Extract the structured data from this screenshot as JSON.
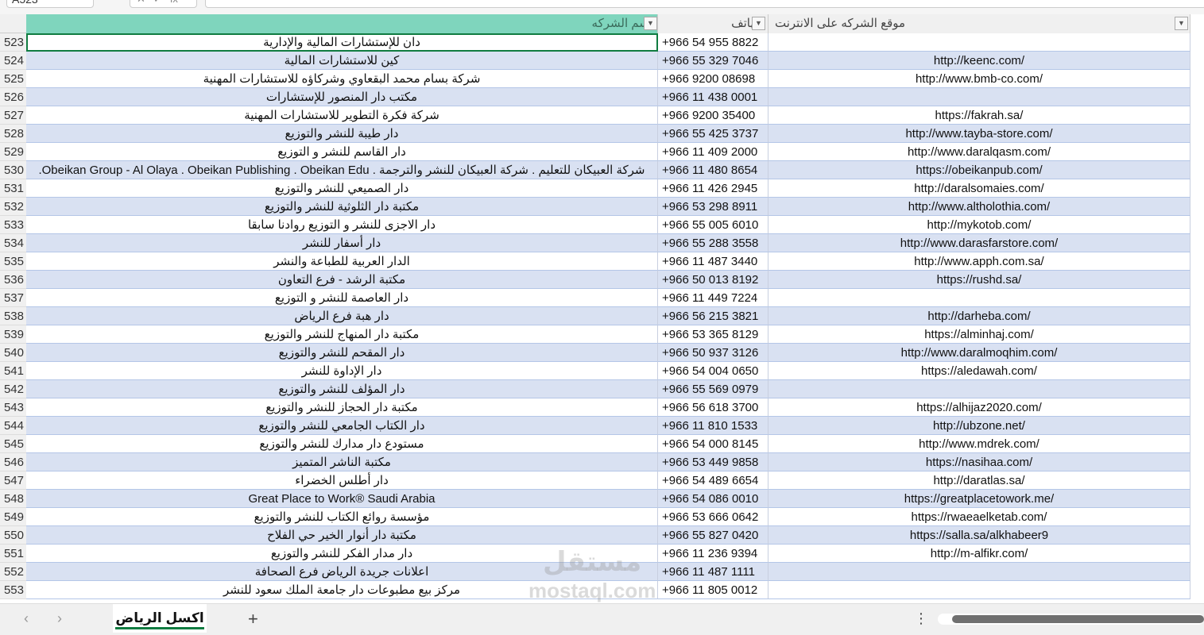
{
  "namebox": "A523",
  "formula_icons": [
    "close-icon",
    "check-icon",
    "fx"
  ],
  "fx_label": "fx",
  "headers": [
    "اسم الشركه",
    "الهاتف",
    "موقع الشركه  على الانترنت"
  ],
  "rows": [
    {
      "n": "523",
      "name": "دان للإستشارات المالية والإدارية",
      "phone": "+966 54 955 8822",
      "web": ""
    },
    {
      "n": "524",
      "name": "كين للاستشارات المالية",
      "phone": "+966 55 329 7046",
      "web": "http://keenc.com/"
    },
    {
      "n": "525",
      "name": "شركة بسام محمد البقعاوي وشركاؤه للاستشارات المهنية",
      "phone": "+966 9200 08698",
      "web": "http://www.bmb-co.com/"
    },
    {
      "n": "526",
      "name": "مكتب دار المنصور للإستشارات",
      "phone": "+966 11 438 0001",
      "web": ""
    },
    {
      "n": "527",
      "name": "شركة فكرة التطوير للاستشارات المهنية",
      "phone": "+966 9200 35400",
      "web": "https://fakrah.sa/"
    },
    {
      "n": "528",
      "name": "دار طيبة للنشر والتوزيع",
      "phone": "+966 55 425 3737",
      "web": "http://www.tayba-store.com/"
    },
    {
      "n": "529",
      "name": "دار القاسم للنشر و التوزيع",
      "phone": "+966 11 409 2000",
      "web": "http://www.daralqasm.com/"
    },
    {
      "n": "530",
      "name": "شركة العبيكان للتعليم . شركة العبيكان للنشر والترجمة . Obeikan Group - Al Olaya . Obeikan Publishing . Obeikan Edu.",
      "phone": "+966 11 480 8654",
      "web": "https://obeikanpub.com/"
    },
    {
      "n": "531",
      "name": "دار الصميعي للنشر والتوزيع",
      "phone": "+966 11 426 2945",
      "web": "http://daralsomaies.com/"
    },
    {
      "n": "532",
      "name": "مكتبة دار الثلوثية للنشر والتوزيع",
      "phone": "+966 53 298 8911",
      "web": "http://www.altholothia.com/"
    },
    {
      "n": "533",
      "name": "دار الاجزى للنشر و التوزيع روادنا سابقا",
      "phone": "+966 55 005 6010",
      "web": "http://mykotob.com/"
    },
    {
      "n": "534",
      "name": "دار أسفار للنشر",
      "phone": "+966 55 288 3558",
      "web": "http://www.darasfarstore.com/"
    },
    {
      "n": "535",
      "name": "الدار العربية للطباعة والنشر",
      "phone": "+966 11 487 3440",
      "web": "http://www.apph.com.sa/"
    },
    {
      "n": "536",
      "name": "مكتبة الرشد - فرع التعاون",
      "phone": "+966 50 013 8192",
      "web": "https://rushd.sa/"
    },
    {
      "n": "537",
      "name": "دار العاصمة للنشر و التوزيع",
      "phone": "+966 11 449 7224",
      "web": ""
    },
    {
      "n": "538",
      "name": "دار هبة فرع الرياض",
      "phone": "+966 56 215 3821",
      "web": "http://darheba.com/"
    },
    {
      "n": "539",
      "name": "مكتبة دار المنهاج للنشر والتوزيع",
      "phone": "+966 53 365 8129",
      "web": "https://alminhaj.com/"
    },
    {
      "n": "540",
      "name": "دار المقحم للنشر والتوزيع",
      "phone": "+966 50 937 3126",
      "web": "http://www.daralmoqhim.com/"
    },
    {
      "n": "541",
      "name": "دار الإداوة للنشر",
      "phone": "+966 54 004 0650",
      "web": "https://aledawah.com/"
    },
    {
      "n": "542",
      "name": "دار المؤلف للنشر والتوزيع",
      "phone": "+966 55 569 0979",
      "web": ""
    },
    {
      "n": "543",
      "name": "مكتبة دار الحجاز للنشر والتوزيع",
      "phone": "+966 56 618 3700",
      "web": "https://alhijaz2020.com/"
    },
    {
      "n": "544",
      "name": "دار الكتاب الجامعي للنشر والتوزيع",
      "phone": "+966 11 810 1533",
      "web": "http://ubzone.net/"
    },
    {
      "n": "545",
      "name": "مستودع دار مدارك للنشر والتوزيع",
      "phone": "+966 54 000 8145",
      "web": "http://www.mdrek.com/"
    },
    {
      "n": "546",
      "name": "مكتبة الناشر المتميز",
      "phone": "+966 53 449 9858",
      "web": "https://nasihaa.com/"
    },
    {
      "n": "547",
      "name": "دار أطلس الخضراء",
      "phone": "+966 54 489 6654",
      "web": "http://daratlas.sa/"
    },
    {
      "n": "548",
      "name": "Great Place to Work® Saudi Arabia",
      "phone": "+966 54 086 0010",
      "web": "https://greatplacetowork.me/"
    },
    {
      "n": "549",
      "name": "مؤسسة روائع الكتاب للنشر والتوزيع",
      "phone": "+966 53 666 0642",
      "web": "https://rwaeaelketab.com/"
    },
    {
      "n": "550",
      "name": "مكتبة دار أنوار الخير حي الفلاح",
      "phone": "+966 55 827 0420",
      "web": "https://salla.sa/alkhabeer9"
    },
    {
      "n": "551",
      "name": "دار مدار الفكر للنشر والتوزيع",
      "phone": "+966 11 236 9394",
      "web": "http://m-alfikr.com/"
    },
    {
      "n": "552",
      "name": "اعلانات جريدة الرياض فرع الصحافة",
      "phone": "+966 11 487 1111",
      "web": ""
    },
    {
      "n": "553",
      "name": "مركز بيع مطبوعات دار جامعة الملك سعود للنشر",
      "phone": "+966 11 805 0012",
      "web": ""
    }
  ],
  "sheet_tab": "اكسل الرياض",
  "add_sheet": "+",
  "watermark": [
    "مستقل",
    "mostaql.com"
  ],
  "colors": {
    "header": "#7fd5bd",
    "alt_row": "#d9e1f2",
    "accent": "#107c41"
  }
}
